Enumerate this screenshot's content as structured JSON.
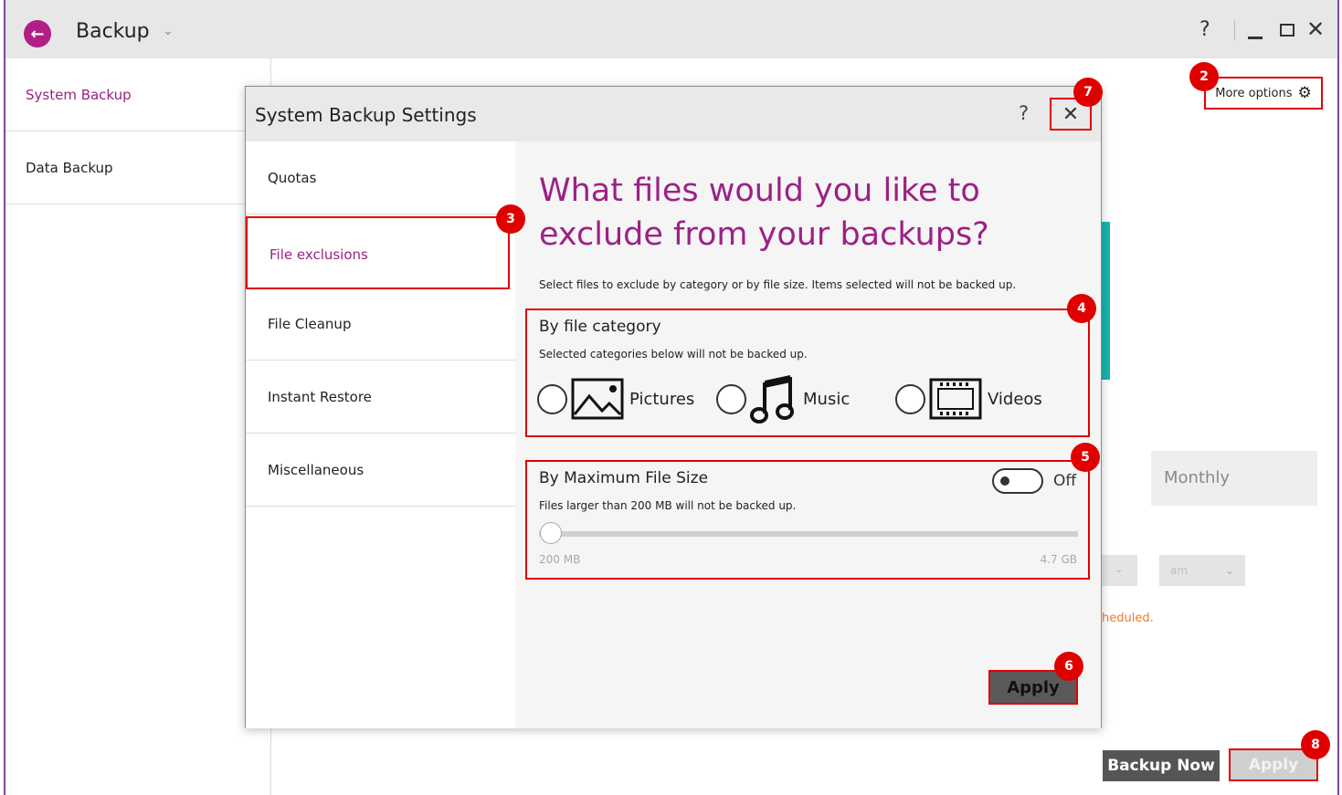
{
  "titlebar": {
    "title": "Backup",
    "help": "?",
    "close": "✕"
  },
  "sidebar": {
    "items": [
      {
        "label": "System Backup"
      },
      {
        "label": "Data Backup"
      }
    ]
  },
  "main": {
    "more_options": "More options",
    "monthly": "Monthly",
    "time_dropdown_value": "am",
    "scheduled_note": "heduled.",
    "backup_now": "Backup Now",
    "apply": "Apply"
  },
  "dialog": {
    "title": "System Backup Settings",
    "help": "?",
    "close": "✕",
    "nav": [
      {
        "label": "Quotas"
      },
      {
        "label": "File exclusions"
      },
      {
        "label": "File Cleanup"
      },
      {
        "label": "Instant Restore"
      },
      {
        "label": "Miscellaneous"
      }
    ],
    "heading": "What files would you like to exclude from your backups?",
    "subtext": "Select files to exclude by category or by file size. Items selected will not be backed up.",
    "by_category": {
      "title": "By file category",
      "description": "Selected categories below will not be backed up.",
      "options": [
        {
          "label": "Pictures",
          "icon": "picture-icon"
        },
        {
          "label": "Music",
          "icon": "music-note-icon"
        },
        {
          "label": "Videos",
          "icon": "film-strip-icon"
        }
      ]
    },
    "by_size": {
      "title": "By Maximum File Size",
      "toggle_label": "Off",
      "description": "Files larger than 200 MB will not be backed up.",
      "slider_min": "200 MB",
      "slider_max": "4.7 GB",
      "slider_position": 0
    },
    "apply": "Apply"
  },
  "badges": [
    "2",
    "3",
    "4",
    "5",
    "6",
    "7",
    "8"
  ],
  "colors": {
    "accent": "#9c2185",
    "highlight": "#e00000",
    "teal": "#1ab3ad",
    "warning": "#f07a28"
  }
}
